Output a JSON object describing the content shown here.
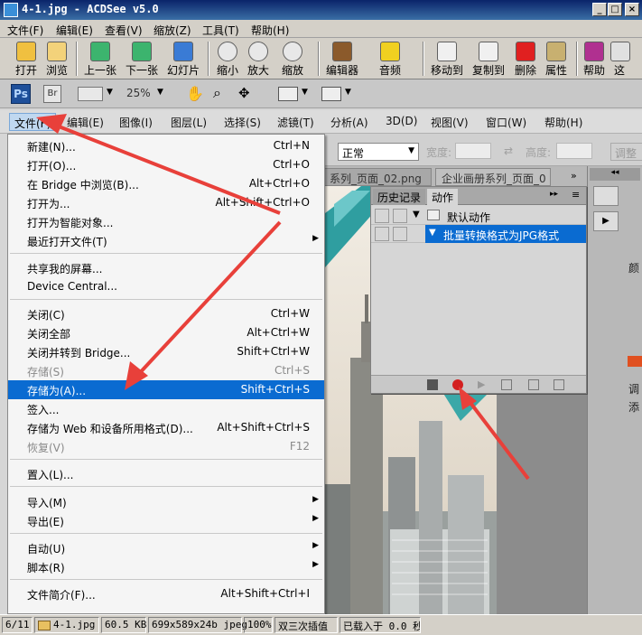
{
  "window": {
    "title": "4-1.jpg - ACDSee v5.0",
    "controls": [
      "_",
      "□",
      "×"
    ]
  },
  "acdsee_menu": [
    "文件(F)",
    "编辑(E)",
    "查看(V)",
    "缩放(Z)",
    "工具(T)",
    "帮助(H)"
  ],
  "acdsee_toolbar": [
    {
      "label": "打开",
      "icon": "open-folder-icon"
    },
    {
      "label": "浏览",
      "icon": "browse-icon"
    },
    {
      "label": "上一张",
      "icon": "previous-image-icon"
    },
    {
      "label": "下一张",
      "icon": "next-image-icon"
    },
    {
      "label": "幻灯片",
      "icon": "slideshow-icon"
    },
    {
      "label": "缩小",
      "icon": "zoom-out-icon"
    },
    {
      "label": "放大",
      "icon": "zoom-in-icon"
    },
    {
      "label": "缩放",
      "icon": "zoom-icon"
    },
    {
      "label": "编辑器",
      "icon": "editor-icon"
    },
    {
      "label": "音频",
      "icon": "audio-icon"
    },
    {
      "label": "移动到",
      "icon": "move-to-icon"
    },
    {
      "label": "复制到",
      "icon": "copy-to-icon"
    },
    {
      "label": "删除",
      "icon": "delete-icon"
    },
    {
      "label": "属性",
      "icon": "properties-icon"
    },
    {
      "label": "帮助",
      "icon": "help-book-icon"
    },
    {
      "label": "这",
      "icon": "whats-this-icon"
    }
  ],
  "ps_appbar": {
    "ps": "Ps",
    "br": "Br",
    "zoom": "25%"
  },
  "ps_menu": [
    "文件(F)",
    "编辑(E)",
    "图像(I)",
    "图层(L)",
    "选择(S)",
    "滤镜(T)",
    "分析(A)",
    "3D(D)",
    "视图(V)",
    "窗口(W)",
    "帮助(H)"
  ],
  "options_bar": {
    "mode": "正常",
    "width_label": "宽度:",
    "height_label": "高度:",
    "adjust_label": "调整"
  },
  "doc_tabs": [
    "系列_页面_02.png",
    "企业画册系列_页面_0"
  ],
  "right_dock": {
    "labels": [
      "颜",
      "调",
      "添"
    ]
  },
  "actions_panel": {
    "tabs": [
      "历史记录",
      "动作"
    ],
    "rows": [
      {
        "label": "默认动作"
      },
      {
        "label": "批量转换格式为JPG格式"
      }
    ]
  },
  "file_menu": {
    "groups": [
      [
        {
          "label": "新建(N)...",
          "shortcut": "Ctrl+N"
        },
        {
          "label": "打开(O)...",
          "shortcut": "Ctrl+O"
        },
        {
          "label": "在 Bridge 中浏览(B)...",
          "shortcut": "Alt+Ctrl+O"
        },
        {
          "label": "打开为...",
          "shortcut": "Alt+Shift+Ctrl+O"
        },
        {
          "label": "打开为智能对象..."
        },
        {
          "label": "最近打开文件(T)",
          "submenu": true
        }
      ],
      [
        {
          "label": "共享我的屏幕..."
        },
        {
          "label": "Device Central..."
        }
      ],
      [
        {
          "label": "关闭(C)",
          "shortcut": "Ctrl+W"
        },
        {
          "label": "关闭全部",
          "shortcut": "Alt+Ctrl+W"
        },
        {
          "label": "关闭并转到 Bridge...",
          "shortcut": "Shift+Ctrl+W"
        },
        {
          "label": "存储(S)",
          "shortcut": "Ctrl+S",
          "disabled": true
        },
        {
          "label": "存储为(A)...",
          "shortcut": "Shift+Ctrl+S",
          "highlight": true
        },
        {
          "label": "签入..."
        },
        {
          "label": "存储为 Web 和设备所用格式(D)...",
          "shortcut": "Alt+Shift+Ctrl+S"
        },
        {
          "label": "恢复(V)",
          "shortcut": "F12",
          "disabled": true
        }
      ],
      [
        {
          "label": "置入(L)..."
        }
      ],
      [
        {
          "label": "导入(M)",
          "submenu": true
        },
        {
          "label": "导出(E)",
          "submenu": true
        }
      ],
      [
        {
          "label": "自动(U)",
          "submenu": true
        },
        {
          "label": "脚本(R)",
          "submenu": true
        }
      ],
      [
        {
          "label": "文件简介(F)...",
          "shortcut": "Alt+Shift+Ctrl+I"
        }
      ]
    ]
  },
  "statusbar": [
    "6/11",
    "4-1.jpg",
    "60.5 KB",
    "699x589x24b jpeg",
    "100%",
    "双三次插值",
    "已载入于 0.0 秒"
  ],
  "colors": {
    "titlebar": "#0a246a",
    "menu_highlight": "#0a6bd1",
    "annotation_arrow": "#e8403a",
    "teal": "#3aa8a8"
  }
}
